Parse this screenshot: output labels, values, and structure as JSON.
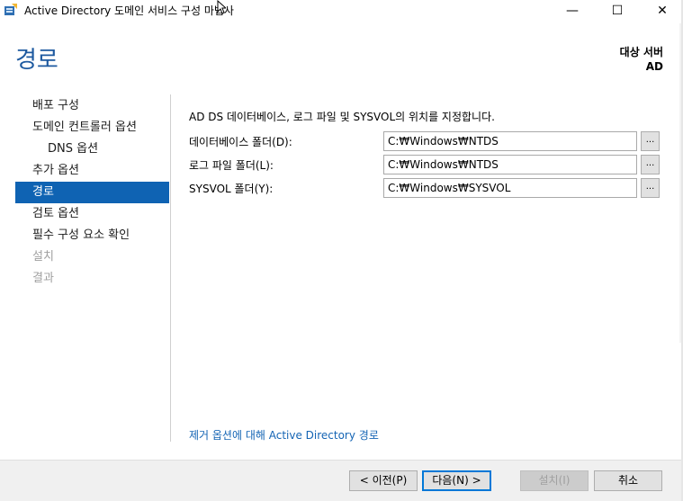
{
  "window": {
    "title": "Active Directory 도메인 서비스 구성 마법사",
    "minimize_glyph": "—",
    "maximize_glyph": "☐",
    "close_glyph": "✕",
    "app_icon": "server-wizard-icon"
  },
  "header": {
    "page_title": "경로",
    "target_server_label": "대상 서버",
    "target_server_name": "AD"
  },
  "nav": {
    "items": [
      {
        "label": "배포 구성",
        "state": "normal"
      },
      {
        "label": "도메인 컨트롤러 옵션",
        "state": "normal"
      },
      {
        "label": "DNS 옵션",
        "state": "sub"
      },
      {
        "label": "추가 옵션",
        "state": "normal"
      },
      {
        "label": "경로",
        "state": "active"
      },
      {
        "label": "검토 옵션",
        "state": "normal"
      },
      {
        "label": "필수 구성 요소 확인",
        "state": "normal"
      },
      {
        "label": "설치",
        "state": "disabled"
      },
      {
        "label": "결과",
        "state": "disabled"
      }
    ]
  },
  "main": {
    "description": "AD DS 데이터베이스, 로그 파일 및 SYSVOL의 위치를 지정합니다.",
    "fields": [
      {
        "label": "데이터베이스 폴더(D):",
        "value": "C:₩Windows₩NTDS",
        "browse": "..."
      },
      {
        "label": "로그 파일 폴더(L):",
        "value": "C:₩Windows₩NTDS",
        "browse": "..."
      },
      {
        "label": "SYSVOL 폴더(Y):",
        "value": "C:₩Windows₩SYSVOL",
        "browse": "..."
      }
    ],
    "more_info_link": "제거 옵션에 대해 Active Directory 경로"
  },
  "footer": {
    "prev_label": "< 이전(P)",
    "next_label": "다음(N) >",
    "install_label": "설치(I)",
    "cancel_label": "취소"
  },
  "colors": {
    "title_blue": "#1e5aa0",
    "nav_active_bg": "#0f63b3",
    "link": "#1464b4",
    "footer_bg": "#f0f0f0"
  }
}
